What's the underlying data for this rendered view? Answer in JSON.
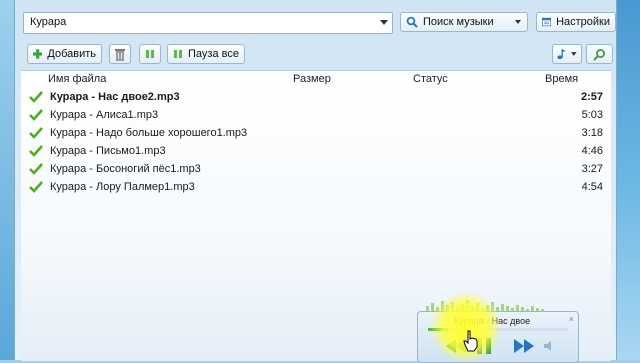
{
  "toolbar": {
    "search_value": "Курара",
    "search_button_label": "Поиск музыки",
    "settings_label": "Настройки",
    "add_label": "Добавить",
    "pause_all_label": "Пауза все"
  },
  "table": {
    "columns": [
      "Имя файла",
      "Размер",
      "Статус",
      "Время"
    ],
    "rows": [
      {
        "name": "Курара - Нас двое2.mp3",
        "time": "2:57",
        "bold": true
      },
      {
        "name": "Курара - Алиса1.mp3",
        "time": "5:03",
        "bold": false
      },
      {
        "name": "Курара - Надо больше хорошего1.mp3",
        "time": "3:18",
        "bold": false
      },
      {
        "name": "Курара - Письмо1.mp3",
        "time": "4:46",
        "bold": false
      },
      {
        "name": "Курара - Босоногий пёс1.mp3",
        "time": "3:27",
        "bold": false
      },
      {
        "name": "Курара - Лору Палмер1.mp3",
        "time": "4:54",
        "bold": false
      }
    ]
  },
  "mini_player": {
    "title": "Курара - Нас двое",
    "progress": 0.15
  },
  "colors": {
    "accent_green": "#3aa23a",
    "check_green": "#4caf1f",
    "button_blue": "#2a73c0"
  }
}
